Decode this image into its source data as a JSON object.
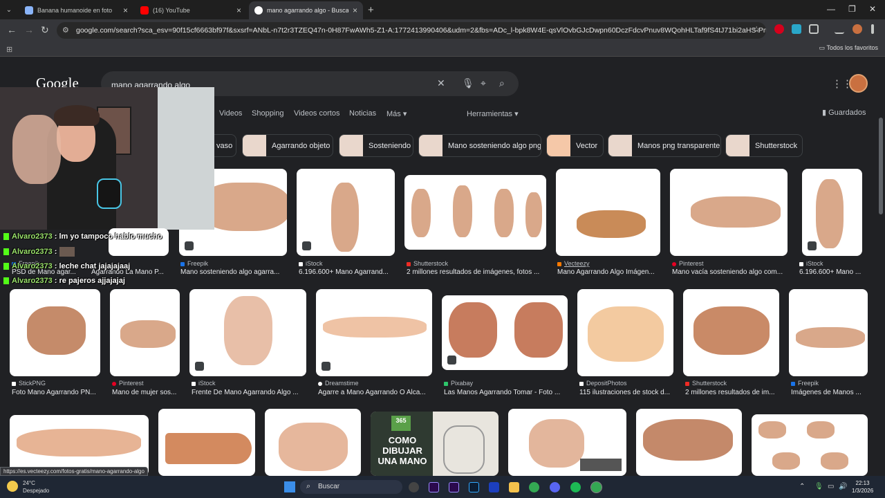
{
  "tabs": [
    {
      "title": "Banana humanoide en foto",
      "color": "#8ab4f8"
    },
    {
      "title": "(16) YouTube",
      "color": "#ff0000"
    },
    {
      "title": "mano agarrando algo - Buscar con",
      "color": "#ffffff"
    }
  ],
  "address": "google.com/search?sca_esv=90f15cf6663bf97f&sxsrf=ANbL-n7t2r3TZEQ47n-0H87FwAWh5-Z1-A:1772413990406&udm=2&fbs=ADc_l-bpk8W4E-qsVlOvbGJcDwpn60DczFdcvPnuv8WQohHLTaf9fS4tJ71bi2aHS-Pmeg0IA2nD...",
  "bookmarks_folder": "Todos los favoritos",
  "logo": "Google",
  "query": "mano agarrando algo",
  "nav": {
    "videos": "Videos",
    "shopping": "Shopping",
    "short": "Videos cortos",
    "news": "Noticias",
    "more": "Más",
    "tools": "Herramientas",
    "saved": "Guardados"
  },
  "chips": [
    "vaso",
    "Agarrando objeto",
    "Sosteniendo",
    "Mano sosteniendo algo png",
    "Vector",
    "Manos png transparente",
    "Shutterstock"
  ],
  "row1": [
    {
      "source": "Freepik",
      "caption": "Mano sosteniendo algo agarra...",
      "color": "#1a73e8"
    },
    {
      "source": "iStock",
      "caption": "6.196.600+ Mano Agarrand...",
      "color": "#ffffff"
    },
    {
      "source": "Shutterstock",
      "caption": "2 millones resultados de imágenes, fotos ...",
      "color": "#ee2b24"
    },
    {
      "source": "Vecteezy",
      "caption": "Mano Agarrando Algo Imágen...",
      "color": "#ff7a00"
    },
    {
      "source": "Pinterest",
      "caption": "Mano vacía sosteniendo algo com...",
      "color": "#e60023"
    },
    {
      "source": "iStock",
      "caption": "6.196.600+ Mano ...",
      "color": "#ffffff"
    }
  ],
  "row0": [
    {
      "source": "Freepik",
      "caption": "PSD de Mano agar..."
    },
    {
      "source": "",
      "caption": "Agarrando La Mano P..."
    }
  ],
  "row2": [
    {
      "source": "StickPNG",
      "caption": "Foto Mano Agarrando PN...",
      "color": "#ffffff"
    },
    {
      "source": "Pinterest",
      "caption": "Mano de mujer sos...",
      "color": "#e60023"
    },
    {
      "source": "iStock",
      "caption": "Frente De Mano Agarrando Algo ...",
      "color": "#ffffff"
    },
    {
      "source": "Dreamstime",
      "caption": "Agarre a Mano Agarrando O Alca...",
      "color": "#ffffff"
    },
    {
      "source": "Pixabay",
      "caption": "Las Manos Agarrando Tomar - Foto ...",
      "color": "#2ec66b"
    },
    {
      "source": "DepositPhotos",
      "caption": "115 ilustraciones de stock d...",
      "color": "#ffffff"
    },
    {
      "source": "Shutterstock",
      "caption": "2 millones resultados de im...",
      "color": "#ee2b24"
    },
    {
      "source": "Freepik",
      "caption": "Imágenes de Manos ...",
      "color": "#1a73e8"
    }
  ],
  "poster": {
    "l1": "365",
    "l2": "COMO",
    "l3": "DIBUJAR",
    "l4": "UNA MANO"
  },
  "chat": [
    {
      "user": "Alvaro2373",
      "msg": " : lm yo tampoco hablo mucho"
    },
    {
      "user": "Alvaro2373",
      "msg": " : "
    },
    {
      "user": "Alvaro2373",
      "msg": " : leche chat jajajajaaj"
    },
    {
      "user": "Alvaro2373",
      "msg": " : re pajeros ajjajajaj"
    }
  ],
  "status_url": "https://es.vecteezy.com/fotos-gratis/mano-agarrando-algo",
  "weather": {
    "temp": "24°C",
    "desc": "Despejado"
  },
  "taskbar_search": "Buscar",
  "clock": {
    "time": "22:13",
    "date": "1/3/2026"
  }
}
